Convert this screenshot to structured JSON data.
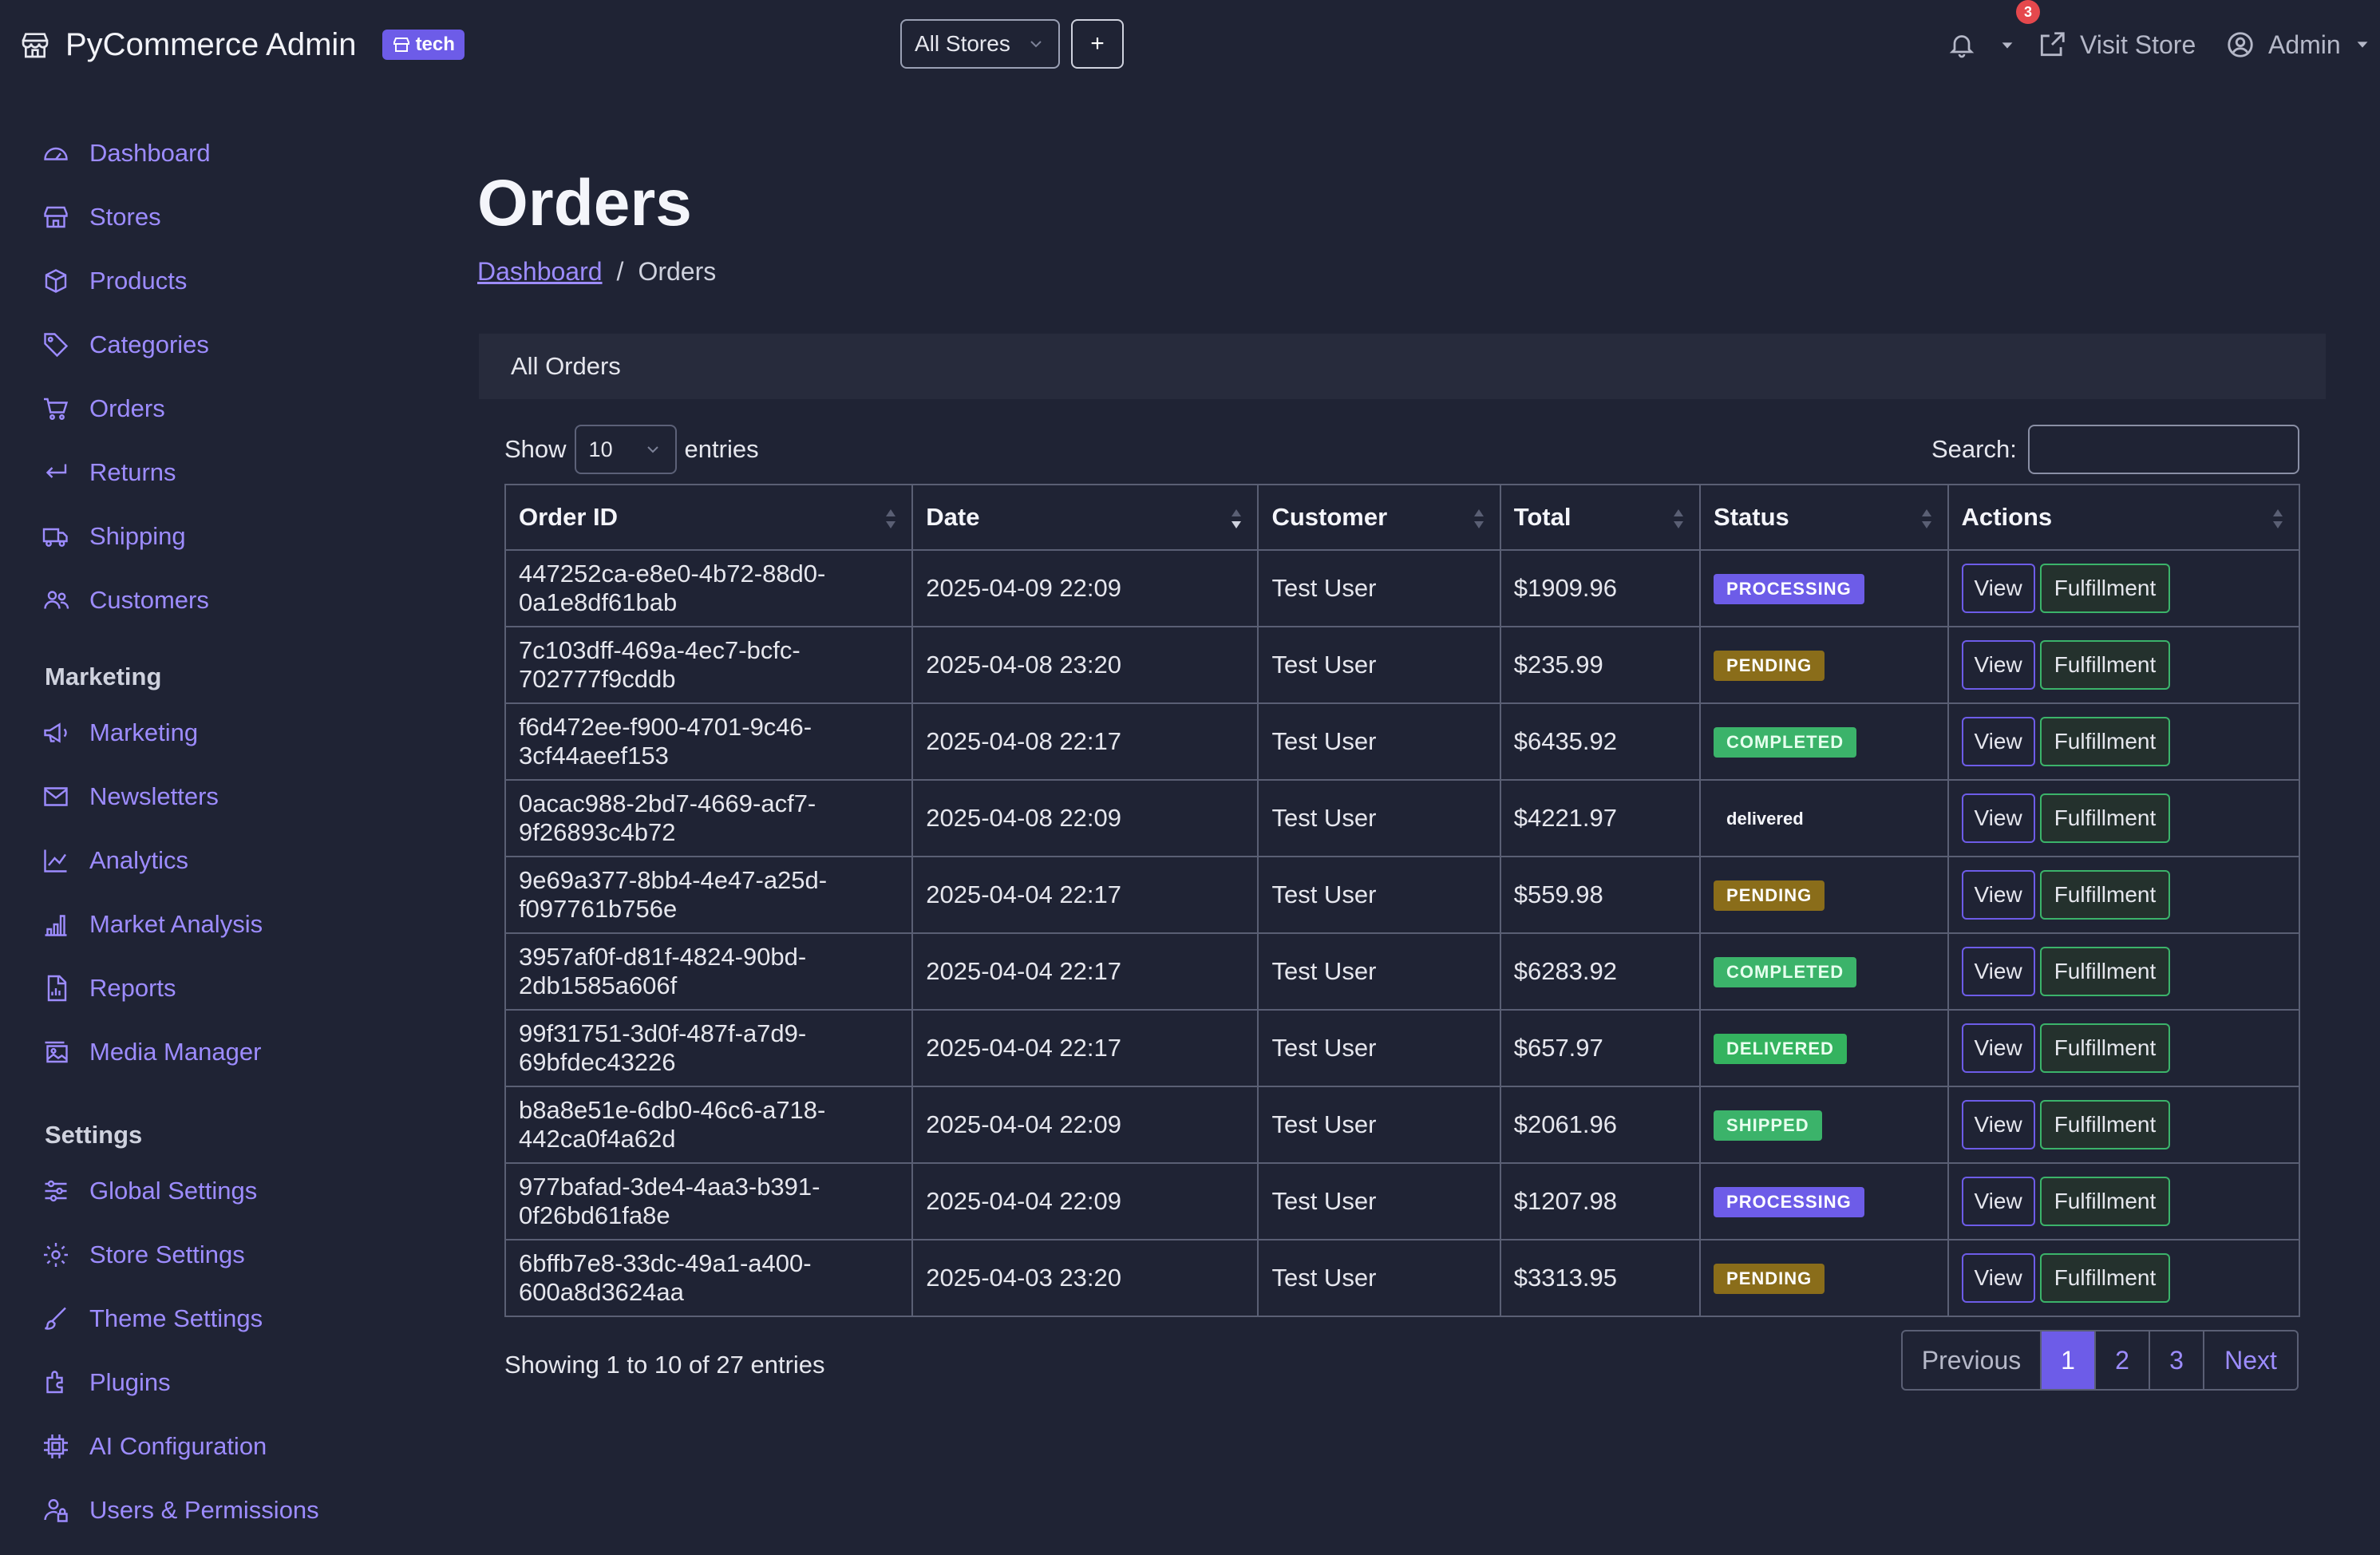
{
  "app": {
    "title": "PyCommerce Admin",
    "badge": "tech",
    "store_select": "All Stores",
    "add_store_label": "+",
    "notification_count": "3",
    "visit_store": "Visit Store",
    "user": "Admin"
  },
  "sidebar": {
    "main_items": [
      {
        "label": "Dashboard",
        "icon": "dashboard-icon"
      },
      {
        "label": "Stores",
        "icon": "store-icon"
      },
      {
        "label": "Products",
        "icon": "box-icon"
      },
      {
        "label": "Categories",
        "icon": "tag-icon"
      },
      {
        "label": "Orders",
        "icon": "cart-icon"
      },
      {
        "label": "Returns",
        "icon": "return-icon"
      },
      {
        "label": "Shipping",
        "icon": "truck-icon"
      },
      {
        "label": "Customers",
        "icon": "people-icon"
      }
    ],
    "marketing_title": "Marketing",
    "marketing_items": [
      {
        "label": "Marketing",
        "icon": "megaphone-icon"
      },
      {
        "label": "Newsletters",
        "icon": "envelope-icon"
      },
      {
        "label": "Analytics",
        "icon": "line-chart-icon"
      },
      {
        "label": "Market Analysis",
        "icon": "bar-chart-icon"
      },
      {
        "label": "Reports",
        "icon": "report-icon"
      },
      {
        "label": "Media Manager",
        "icon": "image-icon"
      }
    ],
    "settings_title": "Settings",
    "settings_items": [
      {
        "label": "Global Settings",
        "icon": "sliders-icon"
      },
      {
        "label": "Store Settings",
        "icon": "gear-icon"
      },
      {
        "label": "Theme Settings",
        "icon": "brush-icon"
      },
      {
        "label": "Plugins",
        "icon": "plugin-icon"
      },
      {
        "label": "AI Configuration",
        "icon": "cpu-icon"
      },
      {
        "label": "Users & Permissions",
        "icon": "user-lock-icon"
      }
    ]
  },
  "page": {
    "title": "Orders",
    "breadcrumb_home": "Dashboard",
    "breadcrumb_sep": "/",
    "breadcrumb_current": "Orders",
    "card_title": "All Orders"
  },
  "table": {
    "show_label": "Show",
    "length_value": "10",
    "entries_label": "entries",
    "search_label": "Search:",
    "columns": [
      "Order ID",
      "Date",
      "Customer",
      "Total",
      "Status",
      "Actions"
    ],
    "view_label": "View",
    "fulfillment_label": "Fulfillment",
    "rows": [
      {
        "id": "447252ca-e8e0-4b72-88d0-0a1e8df61bab",
        "date": "2025-04-09 22:09",
        "customer": "Test User",
        "total": "$1909.96",
        "status": "PROCESSING",
        "status_kind": "processing"
      },
      {
        "id": "7c103dff-469a-4ec7-bcfc-702777f9cddb",
        "date": "2025-04-08 23:20",
        "customer": "Test User",
        "total": "$235.99",
        "status": "PENDING",
        "status_kind": "pending"
      },
      {
        "id": "f6d472ee-f900-4701-9c46-3cf44aeef153",
        "date": "2025-04-08 22:17",
        "customer": "Test User",
        "total": "$6435.92",
        "status": "COMPLETED",
        "status_kind": "completed"
      },
      {
        "id": "0acac988-2bd7-4669-acf7-9f26893c4b72",
        "date": "2025-04-08 22:09",
        "customer": "Test User",
        "total": "$4221.97",
        "status": "delivered",
        "status_kind": "plain"
      },
      {
        "id": "9e69a377-8bb4-4e47-a25d-f097761b756e",
        "date": "2025-04-04 22:17",
        "customer": "Test User",
        "total": "$559.98",
        "status": "PENDING",
        "status_kind": "pending"
      },
      {
        "id": "3957af0f-d81f-4824-90bd-2db1585a606f",
        "date": "2025-04-04 22:17",
        "customer": "Test User",
        "total": "$6283.92",
        "status": "COMPLETED",
        "status_kind": "completed"
      },
      {
        "id": "99f31751-3d0f-487f-a7d9-69bfdec43226",
        "date": "2025-04-04 22:17",
        "customer": "Test User",
        "total": "$657.97",
        "status": "DELIVERED",
        "status_kind": "delivered"
      },
      {
        "id": "b8a8e51e-6db0-46c6-a718-442ca0f4a62d",
        "date": "2025-04-04 22:09",
        "customer": "Test User",
        "total": "$2061.96",
        "status": "SHIPPED",
        "status_kind": "shipped"
      },
      {
        "id": "977bafad-3de4-4aa3-b391-0f26bd61fa8e",
        "date": "2025-04-04 22:09",
        "customer": "Test User",
        "total": "$1207.98",
        "status": "PROCESSING",
        "status_kind": "processing"
      },
      {
        "id": "6bffb7e8-33dc-49a1-a400-600a8d3624aa",
        "date": "2025-04-03 23:20",
        "customer": "Test User",
        "total": "$3313.95",
        "status": "PENDING",
        "status_kind": "pending"
      }
    ],
    "info": "Showing 1 to 10 of 27 entries",
    "pager": {
      "previous": "Previous",
      "pages": [
        "1",
        "2",
        "3"
      ],
      "active": "1",
      "next": "Next"
    }
  },
  "colors": {
    "background": "#1f2334",
    "accent": "#6d5ce8",
    "link": "#9d8cff",
    "success": "#3bb36a",
    "warning": "#8a6d1a",
    "danger": "#e5484d"
  }
}
